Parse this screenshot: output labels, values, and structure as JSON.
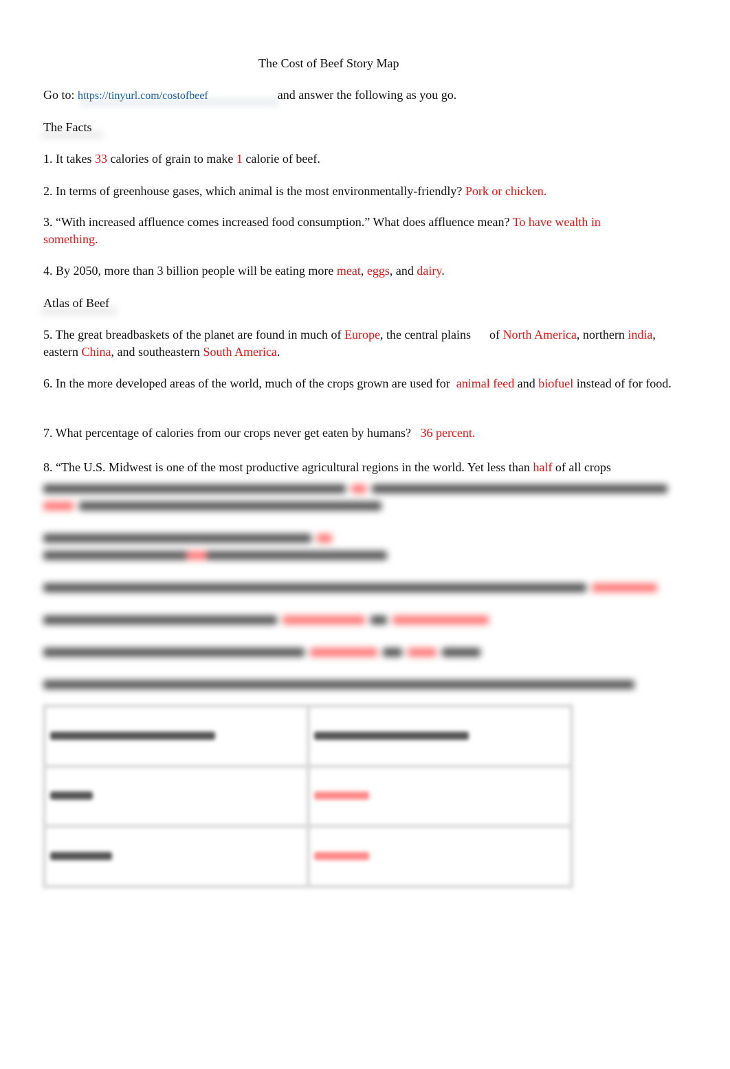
{
  "document": {
    "title": "The Cost of Beef Story Map",
    "goto_prefix": "Go to:",
    "link_text": "https://tinyurl.com/costofbeef",
    "goto_suffix": "and answer the following as you go.",
    "accent_answer_color": "#ee1111",
    "link_color": "#1a5fb4"
  },
  "sections": {
    "facts": "The Facts",
    "atlas": "Atlas of Beef"
  },
  "questions": {
    "q1": {
      "a": "1. It takes ",
      "ans1": "33",
      "b": " calories of grain to make ",
      "ans2": "1",
      "c": " calorie of beef."
    },
    "q2": {
      "a": "2. In terms of greenhouse gases, which animal is the most environmentally-friendly? ",
      "ans": "Pork or chicken."
    },
    "q3": {
      "a": "3. “With increased affluence comes increased food consumption.” What does affluence mean? ",
      "ans": "To have wealth in something."
    },
    "q4": {
      "a": "4. By 2050, more than 3 billion people will be eating more ",
      "ans1": "meat",
      "b": ", ",
      "ans2": "eggs",
      "c": ", and ",
      "ans3": "dairy",
      "d": "."
    },
    "q5": {
      "a": "5. The great breadbaskets of the planet are found in much of ",
      "ans1": "Europe",
      "b": ", the central plains      of ",
      "ans2": "North America",
      "c": ", northern ",
      "ans3": "india",
      "d": ", eastern ",
      "ans4": "China",
      "e": ", and southeastern ",
      "ans5": "South America",
      "f": "."
    },
    "q6": {
      "a": "6. In the more developed areas of the world, much of the crops grown are used for  ",
      "ans1": "animal feed",
      "b": " and ",
      "ans2": "biofuel",
      "c": " instead of for food."
    },
    "q7": {
      "a": "7. What percentage of calories from our crops never get eaten by humans?   ",
      "ans": "36 percent."
    },
    "q8": {
      "a": "8. “The U.S. Midwest is one of the most productive agricultural regions in the world. Yet less than ",
      "ans": "half",
      "b": " of all crops"
    }
  }
}
